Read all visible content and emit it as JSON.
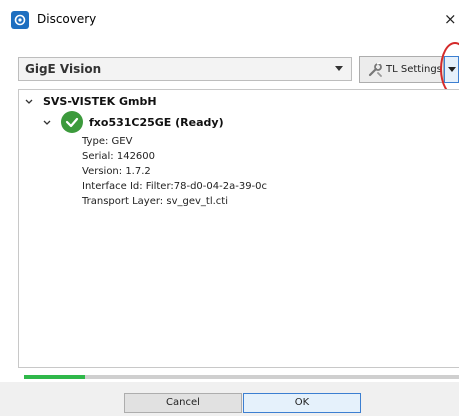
{
  "window": {
    "title": "Discovery",
    "close_glyph": "×",
    "app_icon": "camera-app-icon"
  },
  "toolbar": {
    "interface_value": "GigE Vision",
    "tl_settings_label": "TL Settings",
    "tl_settings_icon": "wrench-icon",
    "highlight_color": "#d42a2a"
  },
  "tree": {
    "vendor": "SVS-VISTEK GmbH",
    "device": {
      "label": "fxo531C25GE (Ready)",
      "status_icon": "check-circle-icon",
      "status_color": "#3c9a3c",
      "properties": {
        "type": "Type: GEV",
        "serial": "Serial: 142600",
        "version": "Version: 1.7.2",
        "interface_id": "Interface Id: Filter:78-d0-04-2a-39-0c",
        "transport_layer": "Transport Layer: sv_gev_tl.cti"
      }
    }
  },
  "progress": {
    "fraction": 0.14,
    "color": "#2fb84a"
  },
  "buttons": {
    "cancel_label": "Cancel",
    "ok_label": "OK"
  }
}
